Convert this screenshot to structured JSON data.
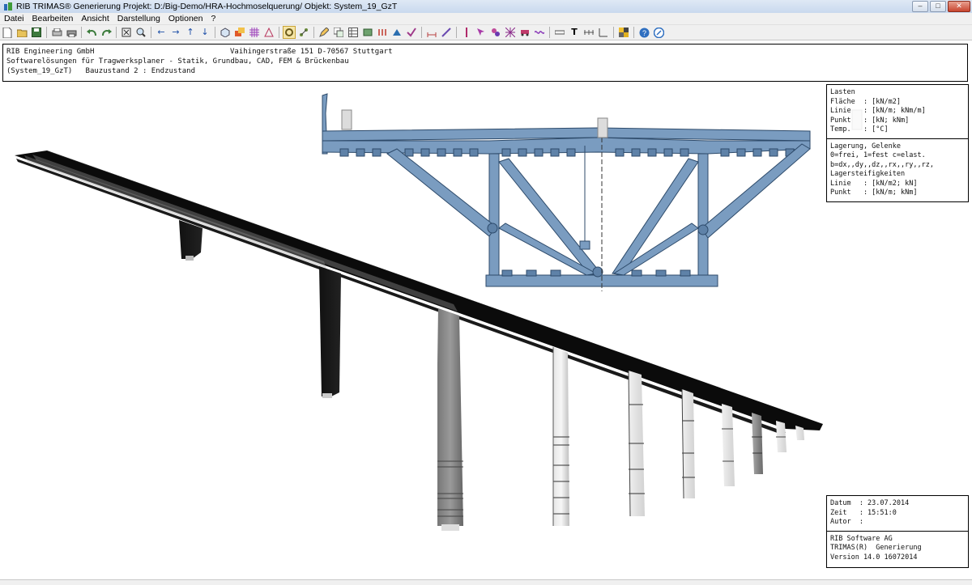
{
  "window": {
    "title": "RIB TRIMAS® Generierung  Projekt: D:/Big-Demo/HRA-Hochmoselquerung/  Objekt: System_19_GzT",
    "minimize": "–",
    "maximize": "□",
    "close": "✕"
  },
  "menu": [
    "Datei",
    "Bearbeiten",
    "Ansicht",
    "Darstellung",
    "Optionen",
    "?"
  ],
  "header": {
    "line1": "RIB Engineering GmbH",
    "address": "Vaihingerstraße 151 D-70567 Stuttgart",
    "line2": "Softwarelösungen für Tragwerksplaner - Statik, Grundbau, CAD, FEM & Brückenbau",
    "line3": "(System_19_GzT)   Bauzustand 2 : Endzustand"
  },
  "legend": {
    "loads": [
      "Lasten",
      "Fläche  : [kN/m2]",
      "Linie   : [kN/m; kNm/m]",
      "Punkt   : [kN; kNm]",
      "Temp.   : [°C]"
    ],
    "supports": [
      "Lagerung, Gelenke",
      "0=frei, 1=fest c=elast.",
      "b=dx,,dy,,dz,,rx,,ry,,rz,",
      "Lagersteifigkeiten",
      "Linie   : [kN/m2; kN]",
      "Punkt   : [kN/m; kNm]"
    ]
  },
  "info": {
    "date": "Datum  : 23.07.2014",
    "time": "Zeit   : 15:51:0",
    "author": "Autor  :",
    "company": "RIB Software AG",
    "product": "TRIMAS(R)  Generierung",
    "version": "Version 14.0 16072014"
  },
  "colors": {
    "section_fill": "#7a9cc0",
    "section_stroke": "#2d4a6a",
    "deck": "#0a0a0a",
    "titlebar": "#dfe9f5"
  }
}
